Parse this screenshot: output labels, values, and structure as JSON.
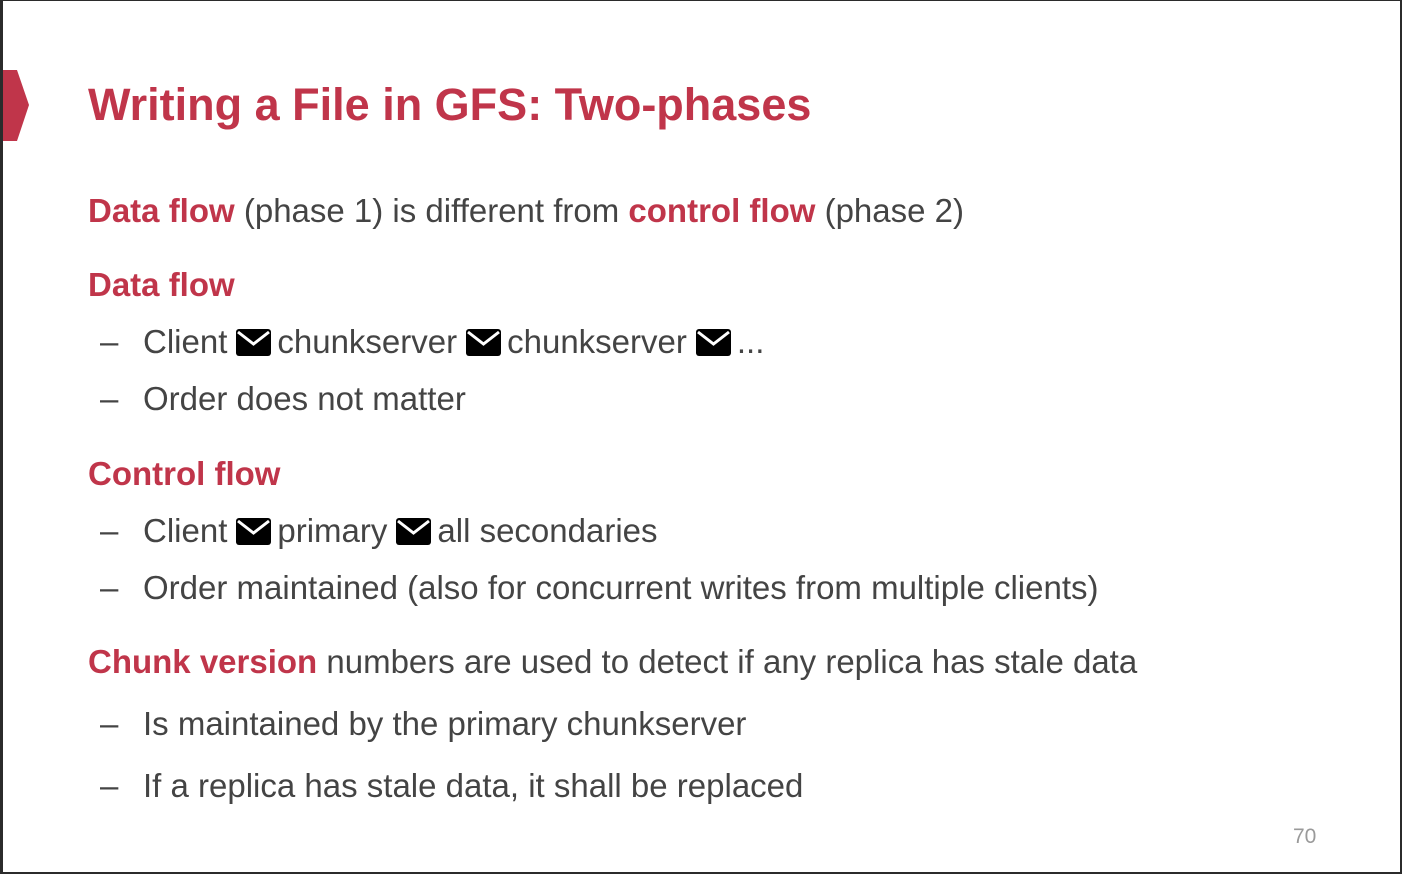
{
  "slide": {
    "title": "Writing a File in GFS: Two-phases",
    "intro": {
      "hl1": "Data flow",
      "text1": " (phase 1) is different from ",
      "hl2": "control flow",
      "text2": " (phase 2)"
    },
    "data_flow": {
      "heading": "Data flow",
      "items": [
        {
          "dash": "–",
          "parts": [
            "Client",
            "chunkserver",
            "chunkserver",
            "..."
          ]
        },
        {
          "dash": "–",
          "text": "Order does not matter"
        }
      ]
    },
    "control_flow": {
      "heading": "Control flow",
      "items": [
        {
          "dash": "–",
          "parts": [
            "Client",
            "primary",
            "all secondaries"
          ]
        },
        {
          "dash": "–",
          "text": "Order maintained (also for concurrent writes from multiple clients)"
        }
      ]
    },
    "chunk_version": {
      "hl": "Chunk version",
      "text": " numbers are used to detect if any replica has stale data",
      "items": [
        {
          "dash": "–",
          "text": "Is maintained by the primary chunkserver"
        },
        {
          "dash": "–",
          "text": "If a replica has stale data, it shall be replaced"
        }
      ]
    },
    "page_number": "70",
    "colors": {
      "accent": "#c0354a",
      "body_text": "#444444",
      "page_number": "#9a9a9a"
    },
    "icons": {
      "message_arrow": "envelope-icon"
    }
  }
}
